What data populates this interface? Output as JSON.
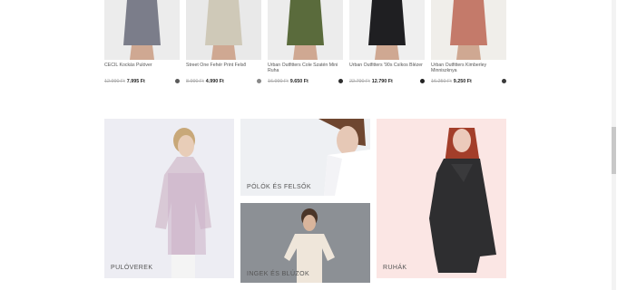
{
  "products": [
    {
      "name": "CECIL Kockás Pulóver",
      "old_price": "12.990 Ft",
      "new_price": "7.995 Ft",
      "dot_color": "#5b5b5b",
      "top_color": "#7b7d8a",
      "bg_color": "#ececec"
    },
    {
      "name": "Street One Fehér Print Felső",
      "old_price": "8.990 Ft",
      "new_price": "4.990 Ft",
      "dot_color": "#888888",
      "top_color": "#cfc9b8",
      "bg_color": "#e9e9e9"
    },
    {
      "name": "Urban Outfitters Cole Szatén Mini Ruha",
      "old_price": "16.990 Ft",
      "new_price": "9.650 Ft",
      "dot_color": "#2e2e2e",
      "top_color": "#5a6b3c",
      "bg_color": "#ececec"
    },
    {
      "name": "Urban Outfitters '90s Csíkos Blézer",
      "old_price": "22.790 Ft",
      "new_price": "12.790 Ft",
      "dot_color": "#222222",
      "top_color": "#1f1f22",
      "bg_color": "#efefef"
    },
    {
      "name": "Urban Outfitters Kimberley Minniszknya",
      "old_price": "16.250 Ft",
      "new_price": "9.250 Ft",
      "dot_color": "#3a3a3a",
      "top_color": "#c47a6a",
      "bg_color": "#f0eeea"
    }
  ],
  "categories": {
    "pulloverek": "PULÓVEREK",
    "polok": "PÓLÓK ÉS FELSŐK",
    "ingek": "INGEK ÉS BLÚZOK",
    "ruhak": "RUHÁK"
  },
  "colors": {
    "pullover_bg": "#ededf3",
    "polok_bg": "#eef0f3",
    "ingek_bg": "#8c9095",
    "ruhak_bg": "#fbe6e4"
  }
}
